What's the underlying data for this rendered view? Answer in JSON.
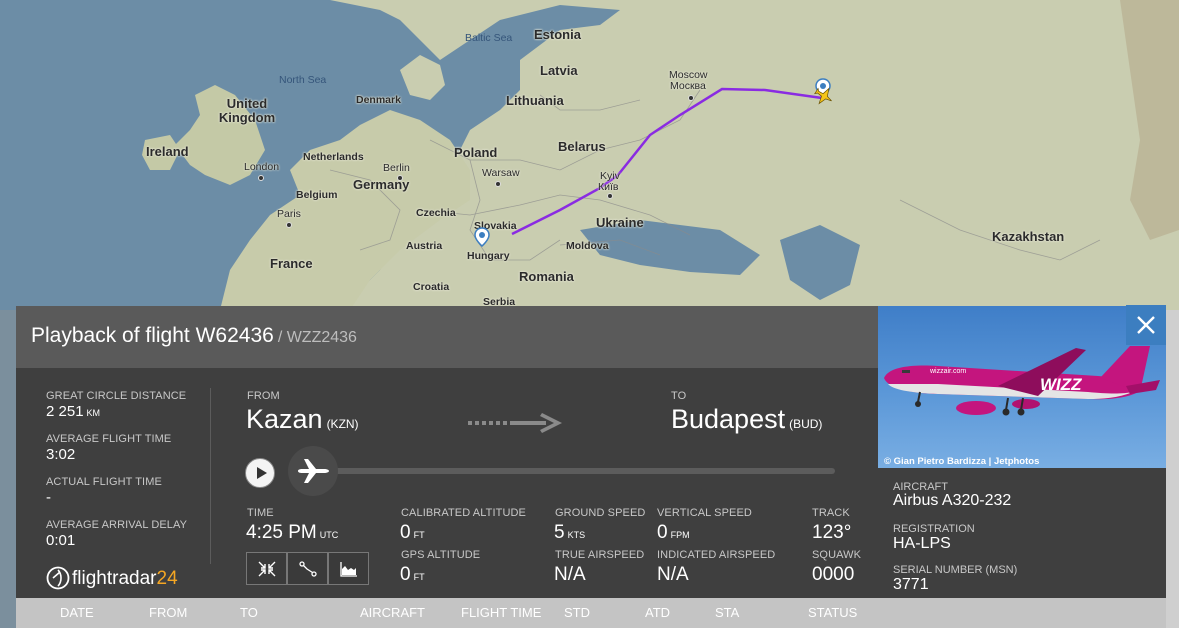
{
  "map": {
    "labels": {
      "estonia": "Estonia",
      "latvia": "Latvia",
      "lithuania": "Lithuania",
      "baltic_sea": "Baltic Sea",
      "north_sea": "North Sea",
      "denmark": "Denmark",
      "united_kingdom": "United Kingdom",
      "ireland": "Ireland",
      "london": "London",
      "netherlands": "Netherlands",
      "berlin": "Berlin",
      "germany": "Germany",
      "belgium": "Belgium",
      "paris": "Paris",
      "france": "France",
      "poland": "Poland",
      "warsaw": "Warsaw",
      "belarus": "Belarus",
      "czechia": "Czechia",
      "slovakia": "Slovakia",
      "austria": "Austria",
      "hungary": "Hungary",
      "croatia": "Croatia",
      "serbia": "Serbia",
      "romania": "Romania",
      "moldova": "Moldova",
      "ukraine": "Ukraine",
      "kyiv": "Kyiv",
      "kyiv_local": "Київ",
      "moscow": "Moscow",
      "moscow_local": "Москва",
      "kazakhstan": "Kazakhstan"
    }
  },
  "panel": {
    "title": "Playback of flight W62436",
    "callsign": "/ WZZ2436"
  },
  "stats": {
    "distance_label": "GREAT CIRCLE DISTANCE",
    "distance_value": "2 251",
    "distance_unit": "KM",
    "avg_time_label": "AVERAGE FLIGHT TIME",
    "avg_time_value": "3:02",
    "actual_time_label": "ACTUAL FLIGHT TIME",
    "actual_time_value": "-",
    "delay_label": "AVERAGE ARRIVAL DELAY",
    "delay_value": "0:01"
  },
  "route": {
    "from_label": "FROM",
    "from_city": "Kazan",
    "from_code": "(KZN)",
    "to_label": "TO",
    "to_city": "Budapest",
    "to_code": "(BUD)"
  },
  "playback": {
    "progress": 0.0
  },
  "telemetry": {
    "time_label": "TIME",
    "time_value": "4:25 PM",
    "time_unit": "UTC",
    "cal_alt_label": "CALIBRATED ALTITUDE",
    "cal_alt_value": "0",
    "cal_alt_unit": "FT",
    "gps_alt_label": "GPS ALTITUDE",
    "gps_alt_value": "0",
    "gps_alt_unit": "FT",
    "ground_speed_label": "GROUND SPEED",
    "ground_speed_value": "5",
    "ground_speed_unit": "KTS",
    "true_airspeed_label": "TRUE AIRSPEED",
    "true_airspeed_value": "N/A",
    "vertical_speed_label": "VERTICAL SPEED",
    "vertical_speed_value": "0",
    "vertical_speed_unit": "FPM",
    "indicated_airspeed_label": "INDICATED AIRSPEED",
    "indicated_airspeed_value": "N/A",
    "track_label": "TRACK",
    "track_value": "123°",
    "squawk_label": "SQUAWK",
    "squawk_value": "0000"
  },
  "logo": {
    "text": "flightradar",
    "number": "24"
  },
  "aircraft": {
    "photo_credit": "© Gian Pietro Bardizza | Jetphotos",
    "photo_livery_text": "wizzair.com",
    "aircraft_label": "AIRCRAFT",
    "aircraft_value": "Airbus A320-232",
    "registration_label": "REGISTRATION",
    "registration_value": "HA-LPS",
    "serial_label": "SERIAL NUMBER (MSN)",
    "serial_value": "3771"
  },
  "table_header": {
    "columns": [
      "DATE",
      "FROM",
      "TO",
      "AIRCRAFT",
      "FLIGHT TIME",
      "STD",
      "ATD",
      "STA",
      "STATUS"
    ]
  },
  "colors": {
    "flight_path": "#8a2be2",
    "panel_bg": "#3f3f3f",
    "header_bg": "#5a5a5a",
    "close_button": "#3c7ec0",
    "logo_accent": "#f5a623"
  }
}
